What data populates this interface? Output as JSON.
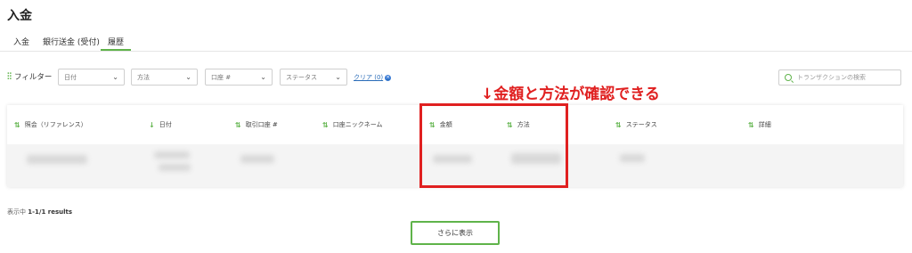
{
  "page": {
    "title": "入金"
  },
  "tabs": [
    {
      "label": "入金"
    },
    {
      "label": "銀行送金 (受付)"
    },
    {
      "label": "履歴"
    }
  ],
  "filters": {
    "label": "フィルター",
    "date": "日付",
    "method": "方法",
    "account": "口座 #",
    "status": "ステータス",
    "clear": "クリア (0)"
  },
  "search": {
    "placeholder": "トランザクションの検索"
  },
  "annotation": "↓金額と方法が確認できる",
  "table": {
    "columns": [
      "照会（リファレンス）",
      "日付",
      "取引口座 #",
      "口座ニックネーム",
      "金額",
      "方法",
      "ステータス",
      "詳細"
    ]
  },
  "results": {
    "prefix": "表示中",
    "count": "1-1/1 results"
  },
  "more_button": "さらに表示",
  "colors": {
    "accent": "#5fb34a",
    "annotation": "#e02020",
    "link": "#2a6cb8"
  }
}
